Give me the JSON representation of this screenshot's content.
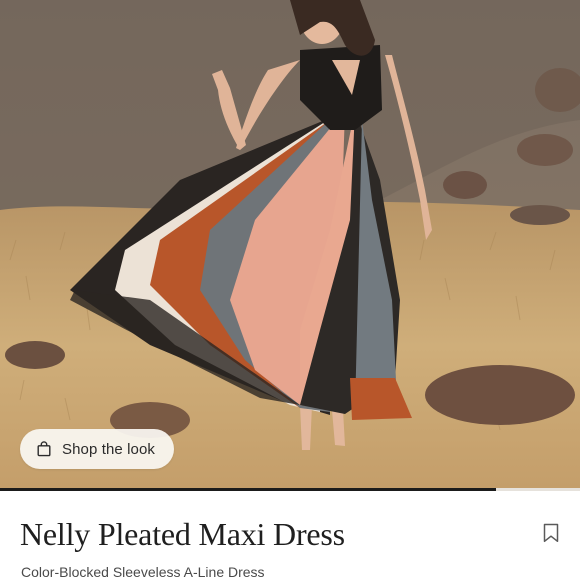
{
  "product": {
    "name": "Nelly Pleated Maxi Dress",
    "subtitle": "Color-Blocked Sleeveless A-Line Dress"
  },
  "hero": {
    "shop_label": "Shop the look",
    "image_progress": 0.855
  },
  "icons": {
    "shop": "shopping-bag-icon",
    "save": "bookmark-icon"
  },
  "colors": {
    "dress_black": "#2a2522",
    "dress_blush": "#e7a58f",
    "dress_rust": "#b8562a",
    "dress_gray": "#6f7478",
    "dress_cream": "#ece2d6",
    "grass": "#c9a46a"
  }
}
